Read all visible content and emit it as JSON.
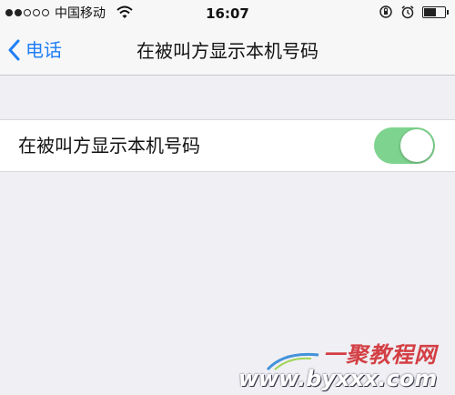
{
  "status_bar": {
    "carrier": "中国移动",
    "time": "16:07",
    "signal_bars_filled": 2,
    "signal_bars_total": 5,
    "battery_level": 0.6
  },
  "nav": {
    "back_label": "电话",
    "title": "在被叫方显示本机号码"
  },
  "setting": {
    "label": "在被叫方显示本机号码",
    "toggle_on": true
  },
  "watermark": {
    "top_text": "一聚教程网",
    "bottom_text": "www.byxxx.com"
  },
  "colors": {
    "accent": "#1f7ff5",
    "toggle_on": "#7ed48e",
    "background": "#efeff4"
  }
}
